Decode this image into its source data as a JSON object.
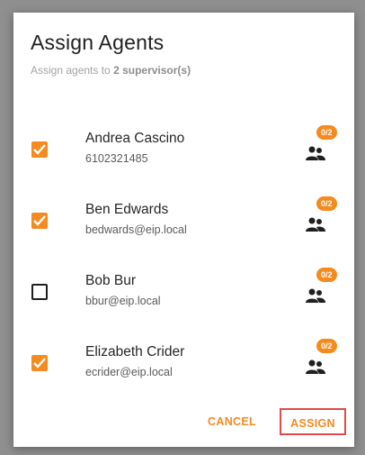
{
  "dialog": {
    "title": "Assign Agents",
    "subtitle_prefix": "Assign agents to ",
    "subtitle_bold": "2 supervisor(s)"
  },
  "agents": [
    {
      "name": "Andrea Cascino",
      "sub": "6102321485",
      "checked": true,
      "badge": "0/2",
      "icon": "group-icon"
    },
    {
      "name": "Ben Edwards",
      "sub": "bedwards@eip.local",
      "checked": true,
      "badge": "0/2",
      "icon": "group-icon"
    },
    {
      "name": "Bob Bur",
      "sub": "bbur@eip.local",
      "checked": false,
      "badge": "0/2",
      "icon": "group-icon"
    },
    {
      "name": "Elizabeth Crider",
      "sub": "ecrider@eip.local",
      "checked": true,
      "badge": "0/2",
      "icon": "group-icon"
    }
  ],
  "actions": {
    "cancel_label": "CANCEL",
    "assign_label": "ASSIGN"
  },
  "colors": {
    "accent": "#f58a1f",
    "highlight_border": "#e04a4a"
  }
}
